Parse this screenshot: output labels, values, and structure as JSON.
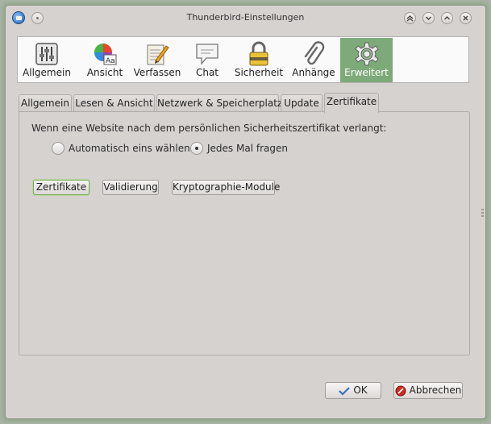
{
  "window": {
    "title": "Thunderbird-Einstellungen",
    "buttons": [
      "shade",
      "minimize",
      "maximize",
      "close"
    ]
  },
  "toolbar": {
    "items": [
      {
        "label": "Allgemein",
        "icon": "sliders-icon"
      },
      {
        "label": "Ansicht",
        "icon": "color-wheel-icon"
      },
      {
        "label": "Verfassen",
        "icon": "compose-icon"
      },
      {
        "label": "Chat",
        "icon": "chat-icon"
      },
      {
        "label": "Sicherheit",
        "icon": "lock-icon"
      },
      {
        "label": "Anhänge",
        "icon": "paperclip-icon"
      },
      {
        "label": "Erweitert",
        "icon": "gear-icon",
        "active": true
      }
    ],
    "active_color": "#7daa78"
  },
  "tabs": [
    {
      "label": "Allgemein"
    },
    {
      "label": "Lesen & Ansicht"
    },
    {
      "label": "Netzwerk & Speicherplatz"
    },
    {
      "label": "Update"
    },
    {
      "label": "Zertifikate",
      "active": true
    }
  ],
  "certificates": {
    "question": "Wenn eine Website nach dem persönlichen Sicherheitszertifikat verlangt:",
    "options": [
      {
        "label": "Automatisch eins wählen",
        "checked": false
      },
      {
        "label": "Jedes Mal fragen",
        "checked": true
      }
    ],
    "buttons": {
      "certificates": "Zertifikate",
      "validation": "Validierung",
      "crypto_modules": "Kryptographie-Module"
    }
  },
  "dialog_buttons": {
    "ok": "OK",
    "cancel": "Abbrechen"
  }
}
